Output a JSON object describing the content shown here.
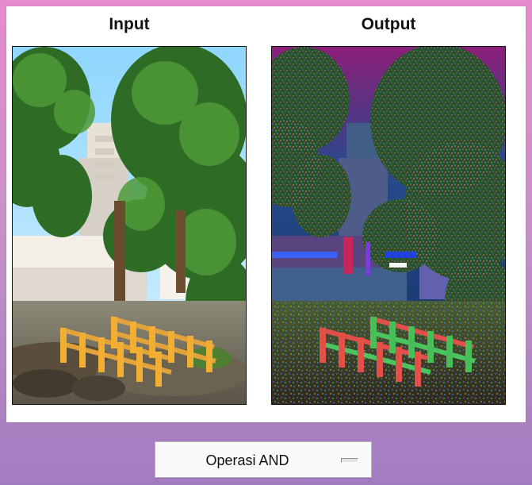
{
  "titles": {
    "input": "Input",
    "output": "Output"
  },
  "images": {
    "input": {
      "kind": "photo",
      "subject": "garden with wooden bridge and trees"
    },
    "output": {
      "kind": "processed-photo",
      "subject": "AND-operation result"
    }
  },
  "controls": {
    "operation_select": {
      "label": "Operasi AND",
      "icon": "dropdown-indicator"
    }
  },
  "colors": {
    "background_top": "#e48ccb",
    "background_bottom": "#a27cc1",
    "panel": "#ffffff",
    "frame_border": "#111111"
  }
}
